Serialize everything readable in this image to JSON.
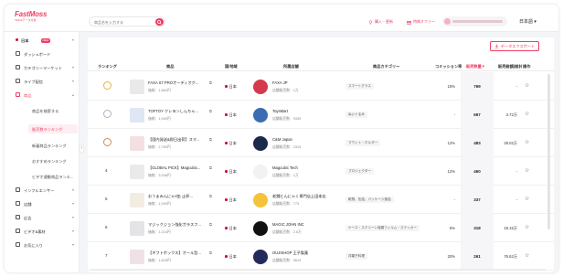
{
  "header": {
    "logo_main": "FastMoss",
    "logo_sub": "TikTokデータ分析",
    "search_placeholder": "商品名を入力する",
    "link_purchase": "購入・更新",
    "link_offer": "特典オファー",
    "language": "日本語"
  },
  "sidebar": {
    "country": "日本",
    "country_badge": "NEW",
    "items": [
      {
        "label": "ダッシュボード",
        "icon": "dashboard-icon"
      },
      {
        "label": "カテゴリーマーケット",
        "icon": "category-icon"
      },
      {
        "label": "ライブ配信",
        "icon": "live-icon"
      },
      {
        "label": "商品",
        "icon": "product-icon",
        "active": true
      },
      {
        "label": "インフルエンサー",
        "icon": "influencer-icon"
      },
      {
        "label": "店舗",
        "icon": "store-icon"
      },
      {
        "label": "広告",
        "icon": "ad-icon"
      },
      {
        "label": "ビデオ&素材",
        "icon": "video-icon"
      },
      {
        "label": "お気に入り",
        "icon": "favorite-icon"
      }
    ],
    "product_sub": [
      {
        "label": "商品を検索する"
      },
      {
        "label": "販売数ランキング",
        "active": true
      },
      {
        "label": "新着商品ランキング"
      },
      {
        "label": "おすすめランキング"
      },
      {
        "label": "ビデオ連動商品ランキ..."
      }
    ]
  },
  "toolbar": {
    "export_label": "データエクスポート"
  },
  "table": {
    "columns": [
      "ランキング",
      "商品",
      "国/地域",
      "所属店舗",
      "商品カテゴリー",
      "コミッション率",
      "販売数量",
      "販売総額(総計)",
      "操作"
    ],
    "sort_indicator": "▼",
    "rows": [
      {
        "rank": "1",
        "medal": "gold",
        "name": "FAXA S7 PROオーディオグ...",
        "price": "価格：1,884円",
        "region": "日本",
        "shop": "FAXA JP",
        "shop_sales": "店舗販売数：1万",
        "category": "スマートグラス",
        "commission": "15%",
        "sales": "769",
        "amount": "-",
        "img_color": "#e9e9ea",
        "shop_logo_color": "#d33a4b"
      },
      {
        "rank": "2",
        "medal": "silver",
        "name": "TOFTOY クレヨンしんちゃ...",
        "price": "価格：1,949円",
        "region": "日本",
        "shop": "ToysMart",
        "shop_sales": "店舗販売数：9339",
        "category": "ぬいぐるみ",
        "commission": "-",
        "sales": "697",
        "amount": "3.72万",
        "img_color": "#dfe6f4",
        "shop_logo_color": "#3c6db3"
      },
      {
        "rank": "3",
        "medal": "bronze",
        "name": "【国内発送&即日出荷】スマ...",
        "price": "価格：2,780円",
        "region": "日本",
        "shop": "C&M Japan",
        "shop_sales": "店舗販売数：2319",
        "category": "マウント・ホルダー",
        "commission": "12%",
        "sales": "483",
        "amount": "28.02万",
        "img_color": "#f2e0e2",
        "shop_logo_color": "#1b2a4a"
      },
      {
        "rank": "4",
        "medal": "",
        "name": "【GLOBAL PICK】Magcubic...",
        "price": "価格：3,938円",
        "region": "日本",
        "shop": "Magcubic Tech",
        "shop_sales": "店舗販売数：1万",
        "category": "プロジェクター",
        "commission": "12%",
        "sales": "460",
        "amount": "-",
        "img_color": "#eaeaea",
        "shop_logo_color": "#f2f2f2"
      },
      {
        "rank": "5",
        "medal": "",
        "name": "おうまみんにゃ4缶 止杯...",
        "price": "価格：1,090円",
        "region": "日本",
        "shop": "老舗とんにゃく専門店上田本店",
        "shop_sales": "店舗販売数：773",
        "category": "乾物、缶詰、パッケージ食品",
        "commission": "-",
        "sales": "337",
        "amount": "-",
        "img_color": "#f3ece2",
        "shop_logo_color": "#f4c33a"
      },
      {
        "rank": "6",
        "medal": "",
        "name": "マジックジョン強化ガラスフ...",
        "price": "価格：1,216円",
        "region": "日本",
        "shop": "MAGIC JOHN INC",
        "shop_sales": "店舗販売数：2.6万",
        "category": "ケース・スクリーン保護フィルム・ステッカー",
        "commission": "5%",
        "sales": "318",
        "amount": "19.15万",
        "img_color": "#e4e4e6",
        "shop_logo_color": "#111111"
      },
      {
        "rank": "7",
        "medal": "",
        "name": "【ギフトボックス】オール型...",
        "price": "価格：1,625円",
        "region": "日本",
        "shop": "OUJISHOP 王子製菓",
        "shop_sales": "店舗販売数：9619",
        "category": "洋菓子料理",
        "commission": "20%",
        "sales": "261",
        "amount": "76.62万",
        "img_color": "#efe1e5",
        "shop_logo_color": "#222b5c"
      }
    ]
  },
  "colors": {
    "accent": "#ef3d63",
    "gold": "#e8b73a",
    "silver": "#a9b4c4",
    "bronze": "#d08a55"
  }
}
